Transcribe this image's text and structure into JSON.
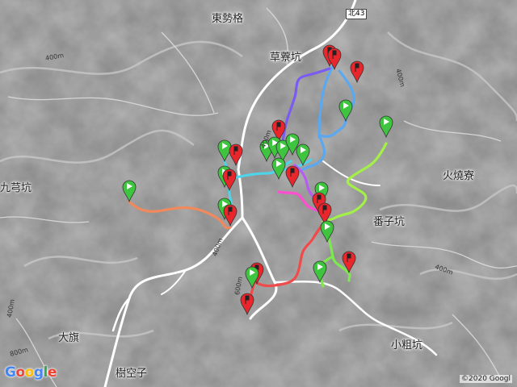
{
  "map": {
    "colors": {
      "terrain": "#8d8d8d",
      "ridge": "#bdbdbd",
      "road": "#ffffff",
      "stream": "#d7d7d7",
      "marker_red": "#e8262b",
      "marker_green": "#3ec43e"
    },
    "places": {
      "dongshige": "東勢格",
      "caoliaokeng": "草藔坑",
      "jiuqiongkeng": "九芎坑",
      "huoshaoliao": "火燒寮",
      "fanzikeng": "番子坑",
      "daqi": "大旗",
      "xiaocukeng": "小粗坑",
      "kongzi": "樹空子"
    },
    "contours": {
      "c1": "400m",
      "c2": "400m",
      "c3": "400m",
      "c4": "400m",
      "c5": "600m",
      "c6": "400m",
      "c7": "800m",
      "c8": "400m"
    },
    "road_shields": {
      "north": "北43"
    },
    "logo": {
      "letters": [
        {
          "ch": "G",
          "color": "#4285f4"
        },
        {
          "ch": "o",
          "color": "#ea4335"
        },
        {
          "ch": "o",
          "color": "#fbbc05"
        },
        {
          "ch": "g",
          "color": "#4285f4"
        },
        {
          "ch": "l",
          "color": "#34a853"
        },
        {
          "ch": "e",
          "color": "#ea4335"
        }
      ]
    },
    "copyright": "©2020 Googl",
    "tracks": [
      {
        "name": "orange",
        "color": "#f08a5d"
      },
      {
        "name": "cyan",
        "color": "#4fd3e8"
      },
      {
        "name": "blue-upper",
        "color": "#5aa8f0"
      },
      {
        "name": "purple",
        "color": "#7b5cf0"
      },
      {
        "name": "magenta",
        "color": "#ff4fd0"
      },
      {
        "name": "violet",
        "color": "#b85cf0"
      },
      {
        "name": "lime",
        "color": "#a3f046"
      },
      {
        "name": "lightgreen",
        "color": "#7ee84f"
      },
      {
        "name": "red",
        "color": "#f04a4a"
      }
    ]
  }
}
